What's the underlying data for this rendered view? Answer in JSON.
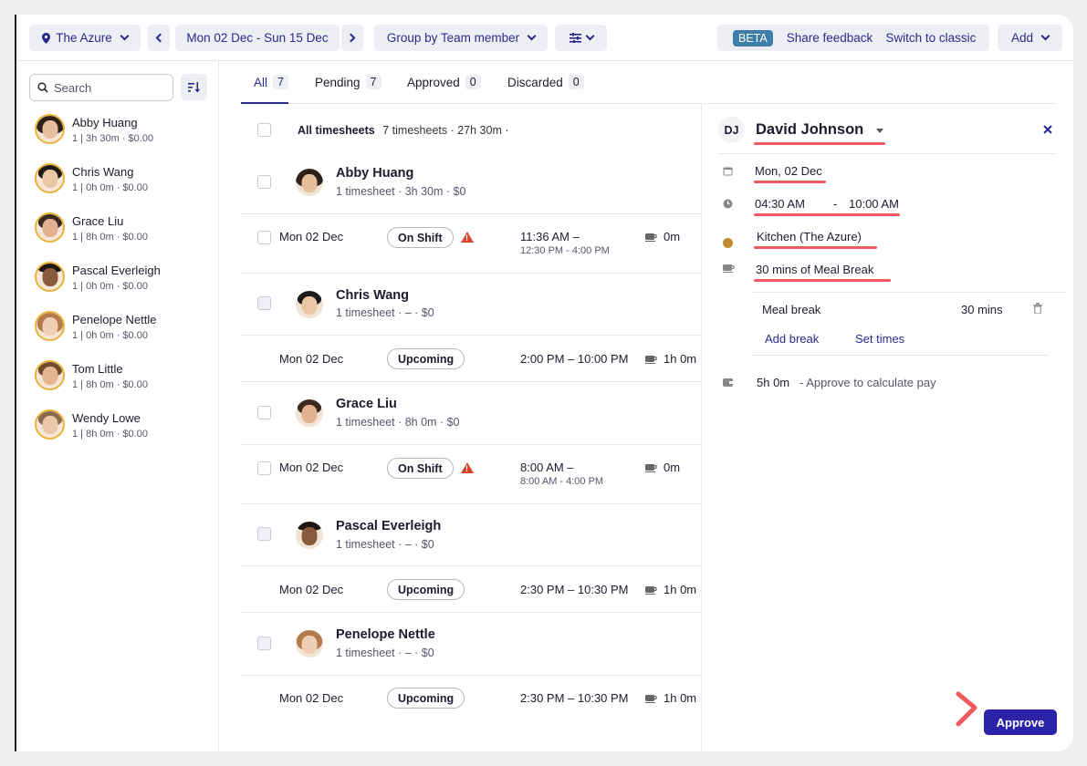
{
  "topbar": {
    "location": "The Azure",
    "date_range": "Mon 02 Dec - Sun 15 Dec",
    "group_by": "Group by Team member",
    "beta": "BETA",
    "share_feedback": "Share feedback",
    "switch_classic": "Switch to classic",
    "add": "Add"
  },
  "sidebar": {
    "search_placeholder": "Search",
    "members": [
      {
        "name": "Abby Huang",
        "sub": "1 | 3h 30m · $0.00"
      },
      {
        "name": "Chris Wang",
        "sub": "1 | 0h 0m · $0.00"
      },
      {
        "name": "Grace Liu",
        "sub": "1 | 8h 0m · $0.00"
      },
      {
        "name": "Pascal Everleigh",
        "sub": "1 | 0h 0m · $0.00"
      },
      {
        "name": "Penelope Nettle",
        "sub": "1 | 0h 0m · $0.00"
      },
      {
        "name": "Tom Little",
        "sub": "1 | 8h 0m · $0.00"
      },
      {
        "name": "Wendy Lowe",
        "sub": "1 | 8h 0m · $0.00"
      }
    ]
  },
  "tabs": [
    {
      "label": "All",
      "count": "7"
    },
    {
      "label": "Pending",
      "count": "7"
    },
    {
      "label": "Approved",
      "count": "0"
    },
    {
      "label": "Discarded",
      "count": "0"
    }
  ],
  "list": {
    "all_label": "All timesheets",
    "all_summary": "7 timesheets · 27h 30m ·",
    "groups": [
      {
        "name": "Abby Huang",
        "sub": "1 timesheet · 3h 30m · $0",
        "date": "Mon 02 Dec",
        "status": "On Shift",
        "warn": true,
        "time": "11:36 AM –",
        "time_sub": "12:30 PM - 4:00 PM",
        "break": "0m"
      },
      {
        "name": "Chris Wang",
        "sub": "1 timesheet · – · $0",
        "date": "Mon 02 Dec",
        "status": "Upcoming",
        "warn": false,
        "time": "2:00 PM – 10:00 PM",
        "time_sub": "",
        "break": "1h 0m"
      },
      {
        "name": "Grace Liu",
        "sub": "1 timesheet · 8h 0m · $0",
        "date": "Mon 02 Dec",
        "status": "On Shift",
        "warn": true,
        "time": "8:00 AM –",
        "time_sub": "8:00 AM - 4:00 PM",
        "break": "0m"
      },
      {
        "name": "Pascal Everleigh",
        "sub": "1 timesheet · – · $0",
        "date": "Mon 02 Dec",
        "status": "Upcoming",
        "warn": false,
        "time": "2:30 PM – 10:30 PM",
        "time_sub": "",
        "break": "1h 0m"
      },
      {
        "name": "Penelope Nettle",
        "sub": "1 timesheet · – · $0",
        "date": "Mon 02 Dec",
        "status": "Upcoming",
        "warn": false,
        "time": "2:30 PM – 10:30 PM",
        "time_sub": "",
        "break": "1h 0m"
      }
    ]
  },
  "detail": {
    "initials": "DJ",
    "name": "David Johnson",
    "date": "Mon, 02 Dec",
    "start": "04:30 AM",
    "dash": "-",
    "end": "10:00 AM",
    "area": "Kitchen (The Azure)",
    "break_summary": "30 mins of Meal Break",
    "break_type": "Meal break",
    "break_len": "30 mins",
    "add_break": "Add break",
    "set_times": "Set times",
    "total": "5h 0m",
    "pay_note": "- Approve to calculate pay",
    "approve": "Approve"
  },
  "colors": {
    "accent": "#2b2a8c",
    "approve": "#2b24a8",
    "highlight": "#f05a5f",
    "beta": "#3d7fa8",
    "area_dot": "#c08a2e"
  }
}
